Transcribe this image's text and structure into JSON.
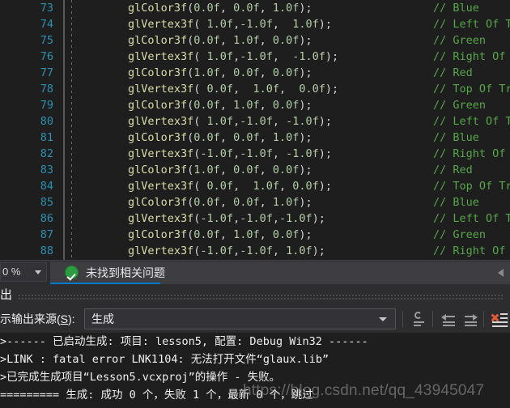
{
  "editor": {
    "first_line_number": 73,
    "lines": [
      {
        "no": "73",
        "code": "glColor3f(0.0f, 0.0f, 1.0f);",
        "comment": "// Blue"
      },
      {
        "no": "74",
        "code": "glVertex3f( 1.0f,-1.0f,  1.0f);",
        "comment": "// Left Of T"
      },
      {
        "no": "75",
        "code": "glColor3f(0.0f, 1.0f, 0.0f);",
        "comment": "// Green"
      },
      {
        "no": "76",
        "code": "glVertex3f( 1.0f,-1.0f,  -1.0f);",
        "comment": "// Right Of"
      },
      {
        "no": "77",
        "code": "glColor3f(1.0f, 0.0f, 0.0f);",
        "comment": "// Red"
      },
      {
        "no": "78",
        "code": "glVertex3f( 0.0f,  1.0f,  0.0f);",
        "comment": "// Top Of Tr"
      },
      {
        "no": "79",
        "code": "glColor3f(0.0f, 1.0f, 0.0f);",
        "comment": "// Green"
      },
      {
        "no": "80",
        "code": "glVertex3f( 1.0f,-1.0f, -1.0f);",
        "comment": "// Left Of T"
      },
      {
        "no": "81",
        "code": "glColor3f(0.0f, 0.0f, 1.0f);",
        "comment": "// Blue"
      },
      {
        "no": "82",
        "code": "glVertex3f(-1.0f,-1.0f, -1.0f);",
        "comment": "// Right Of"
      },
      {
        "no": "83",
        "code": "glColor3f(1.0f, 0.0f, 0.0f);",
        "comment": "// Red"
      },
      {
        "no": "84",
        "code": "glVertex3f( 0.0f,  1.0f, 0.0f);",
        "comment": "// Top Of Tr"
      },
      {
        "no": "85",
        "code": "glColor3f(0.0f, 0.0f, 1.0f);",
        "comment": "// Blue"
      },
      {
        "no": "86",
        "code": "glVertex3f(-1.0f,-1.0f,-1.0f);",
        "comment": "// Left Of T"
      },
      {
        "no": "87",
        "code": "glColor3f(0.0f, 1.0f, 0.0f);",
        "comment": "// Green"
      },
      {
        "no": "88",
        "code": "glVertex3f(-1.0f,-1.0f, 1.0f);",
        "comment": "// Right Of"
      }
    ]
  },
  "statusbar": {
    "zoom_value": "0 %",
    "error_list_message": "未找到相关问题",
    "ok_icon": "check-circle-icon",
    "scroll_left_icon": "scroll-left-arrow-icon"
  },
  "output_panel": {
    "title": "出",
    "source_label_prefix": "示输出来源(",
    "source_label_accel": "S",
    "source_label_suffix": "):",
    "source_value": "生成",
    "toolbar": [
      {
        "name": "clear-search-button",
        "icon": "clear-search-icon"
      },
      {
        "name": "go-to-previous-message-button",
        "icon": "arrow-left-icon"
      },
      {
        "name": "go-to-next-message-button",
        "icon": "arrow-right-icon"
      },
      {
        "name": "clear-all-button",
        "icon": "clear-all-x-icon"
      }
    ],
    "console_lines": [
      ">------ 已启动生成: 项目: lesson5, 配置: Debug Win32 ------",
      ">LINK : fatal error LNK1104: 无法打开文件“glaux.lib”",
      ">已完成生成项目“Lesson5.vcxproj”的操作 - 失败。",
      "========= 生成: 成功 0 个，失败 1 个，最新 0 个，跳过"
    ]
  },
  "watermark": {
    "text": "https://blog.csdn.net/qq_43945047"
  },
  "colors": {
    "editor_background": "#1e1e1e",
    "line_number": "#2b91af",
    "function_name": "#dcdcaa",
    "number_literal": "#b5cea8",
    "comment": "#57a64a",
    "panel_background": "#2d2d30",
    "accent": "#007acc",
    "success": "#2d9b3f",
    "error": "#e05a3a"
  }
}
